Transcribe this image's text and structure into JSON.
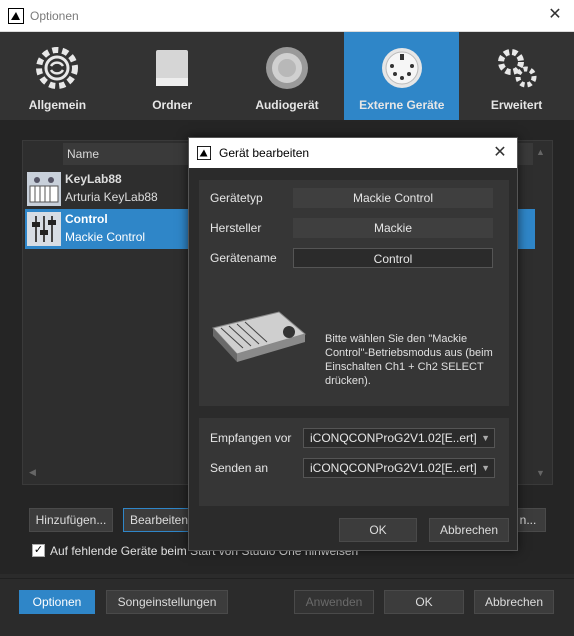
{
  "window": {
    "title": "Optionen"
  },
  "nav": {
    "tabs": [
      {
        "label": "Allgemein",
        "icon": "sync-gear-icon"
      },
      {
        "label": "Ordner",
        "icon": "drive-icon"
      },
      {
        "label": "Audiogerät",
        "icon": "speaker-icon"
      },
      {
        "label": "Externe Geräte",
        "icon": "midi-port-icon",
        "active": true
      },
      {
        "label": "Erweitert",
        "icon": "gears-icon"
      }
    ]
  },
  "devices": {
    "column_name": "Name",
    "items": [
      {
        "name": "KeyLab88",
        "device": "Arturia KeyLab88",
        "icon": "keyboard-icon"
      },
      {
        "name": "Control",
        "device": "Mackie Control",
        "icon": "faders-icon",
        "selected": true
      }
    ]
  },
  "buttons": {
    "add": "Hinzufügen...",
    "edit": "Bearbeiten",
    "more": "n...",
    "options": "Optionen",
    "song_settings": "Songeinstellungen",
    "apply": "Anwenden",
    "ok": "OK",
    "cancel": "Abbrechen"
  },
  "checkbox": {
    "label": "Auf fehlende Geräte beim Start von Studio One hinweisen",
    "checked": true
  },
  "dialog": {
    "title": "Gerät bearbeiten",
    "fields": {
      "type_label": "Gerätetyp",
      "type_value": "Mackie Control",
      "vendor_label": "Hersteller",
      "vendor_value": "Mackie",
      "name_label": "Gerätename",
      "name_value": "Control"
    },
    "info": "Bitte wählen Sie den \"Mackie Control\"-Betriebsmodus aus (beim Einschalten Ch1 + Ch2 SELECT drücken).",
    "receive_label": "Empfangen vor",
    "receive_value": "iCONQCONProG2V1.02[E..ert]",
    "send_label": "Senden an",
    "send_value": "iCONQCONProG2V1.02[E..ert]",
    "ok": "OK",
    "cancel": "Abbrechen"
  },
  "colors": {
    "accent": "#2f86c8",
    "bg": "#252525"
  }
}
